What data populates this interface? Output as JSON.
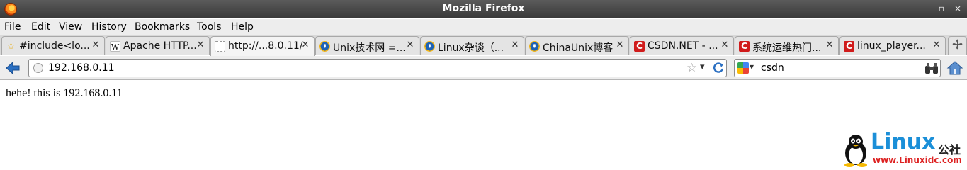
{
  "window": {
    "title": "Mozilla Firefox",
    "controls": [
      "_",
      "▫",
      "×"
    ]
  },
  "menu": [
    "File",
    "Edit",
    "View",
    "History",
    "Bookmarks",
    "Tools",
    "Help"
  ],
  "tabs": [
    {
      "label": "#include<lo...",
      "icon": "star-icon",
      "active": false
    },
    {
      "label": "Apache HTTP...",
      "icon": "wikipedia-icon",
      "active": false
    },
    {
      "label": "http://...8.0.11/",
      "icon": "blank-page-icon",
      "active": true
    },
    {
      "label": "Unix技术网 =...",
      "icon": "chinaunix-icon",
      "active": false
    },
    {
      "label": "Linux杂谈（...",
      "icon": "chinaunix-icon",
      "active": false
    },
    {
      "label": "ChinaUnix博客",
      "icon": "chinaunix-icon",
      "active": false
    },
    {
      "label": "CSDN.NET - ...",
      "icon": "csdn-icon",
      "active": false
    },
    {
      "label": "系统运维热门...",
      "icon": "csdn-icon",
      "active": false
    },
    {
      "label": "linux_player...",
      "icon": "csdn-icon",
      "active": false
    }
  ],
  "tab_glyphs": {
    "w": "W",
    "u": "U",
    "c": "C",
    "star": "✩",
    "close": "✕",
    "new_tab": "✢"
  },
  "navigation": {
    "url": "192.168.0.11",
    "search_value": "csdn"
  },
  "page": {
    "body_text": "hehe! this is 192.168.0.11"
  },
  "watermark": {
    "brand": "Linux",
    "brand_cn": "公社",
    "url": "www.Linuxidc.com"
  },
  "colors": {
    "titlebar": "#3a3a3a",
    "watermark_blue": "#1b8fd8",
    "watermark_red": "#dd2222",
    "csdn_red": "#d01b1b"
  }
}
